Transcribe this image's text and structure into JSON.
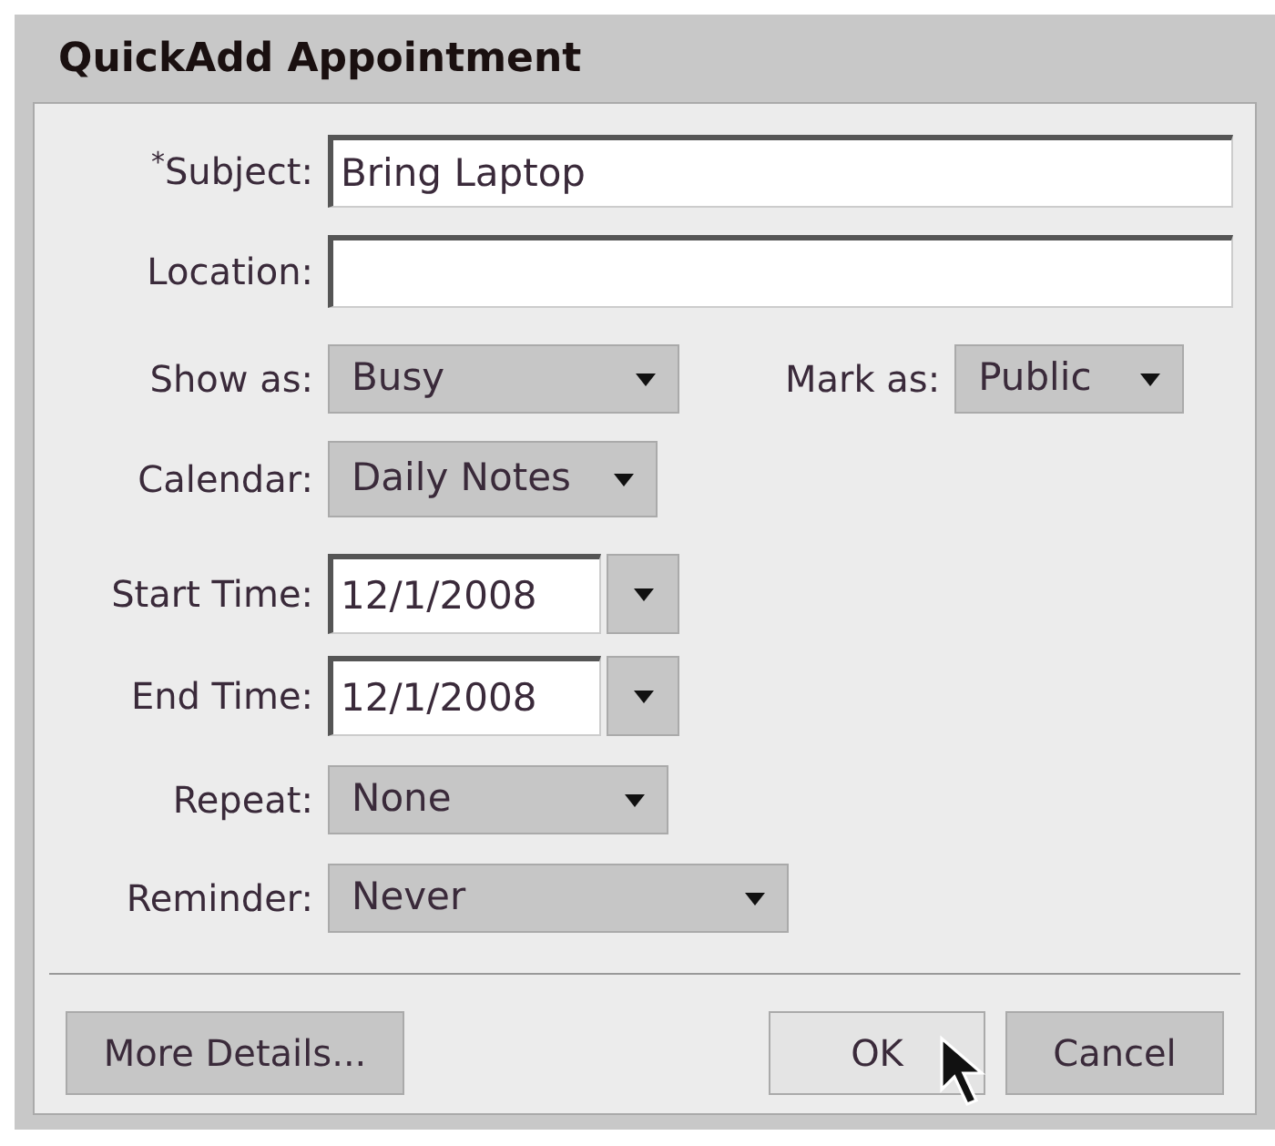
{
  "dialog": {
    "title": "QuickAdd Appointment"
  },
  "rows": [
    {
      "fields": [
        {
          "label": "$^{*}$Subject:",
          "kind": "text",
          "value": "Bring Laptop"
        }
      ]
    },
    {
      "fields": [
        {
          "label": "Location:",
          "kind": "text"
        }
      ]
    },
    {
      "fields": [
        {
          "label": "Show as:",
          "kind": "select",
          "value": "Busy"
        },
        {
          "label": "Mark as:",
          "kind": "select",
          "value": "Public"
        }
      ]
    },
    {
      "fields": [
        {
          "label": "Calendar:",
          "kind": "select",
          "value": "Daily Notes"
        }
      ]
    },
    {
      "fields": [
        {
          "label": "Start Time:",
          "kind": "date",
          "value": "12/1/2008"
        }
      ]
    },
    {
      "fields": [
        {
          "label": "End Time:",
          "kind": "date",
          "value": "12/1/2008"
        }
      ]
    },
    {
      "fields": [
        {
          "label": "Repeat:",
          "kind": "select",
          "value": "None"
        }
      ]
    },
    {
      "fields": [
        {
          "label": "Reminder:",
          "kind": "select",
          "value": "Never"
        }
      ]
    }
  ],
  "buttons": [
    {
      "label": "More Details...",
      "hovered": false
    },
    {
      "label": "OK",
      "hovered": true
    },
    {
      "label": "Cancel",
      "hovered": false
    }
  ]
}
